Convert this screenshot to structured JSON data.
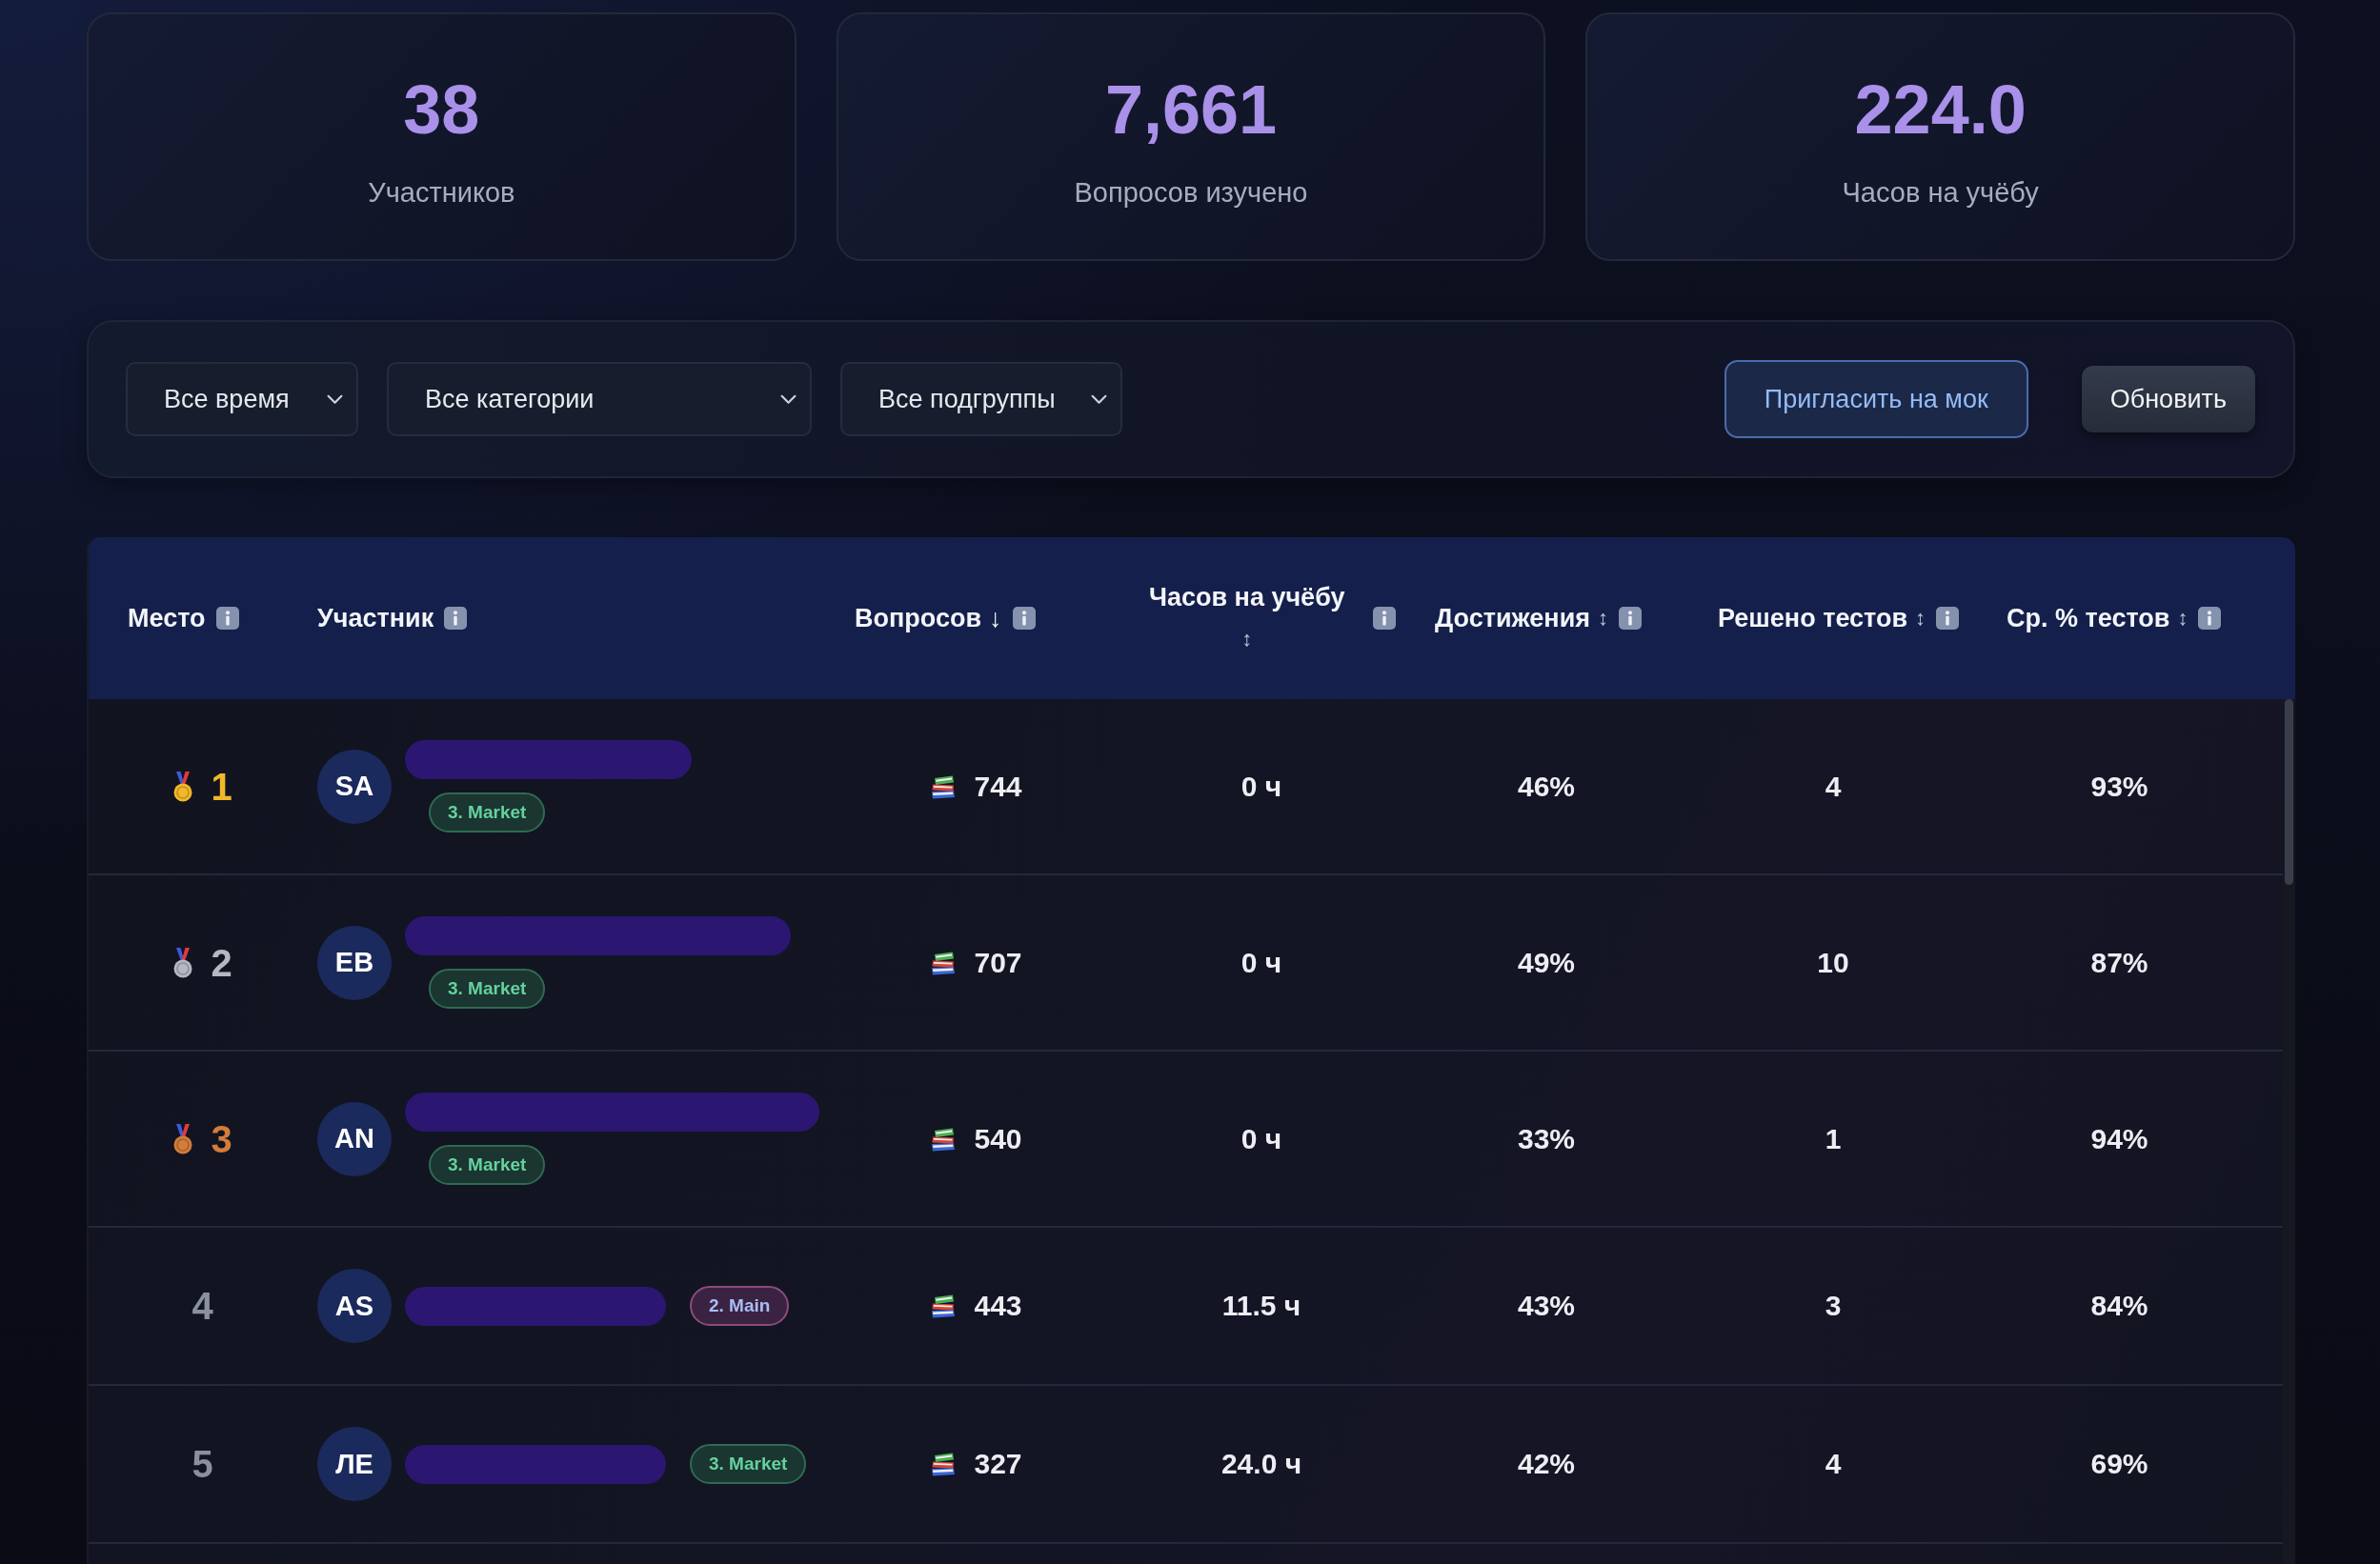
{
  "stats": [
    {
      "value": "38",
      "label": "Участников"
    },
    {
      "value": "7,661",
      "label": "Вопросов изучено"
    },
    {
      "value": "224.0",
      "label": "Часов на учёбу"
    }
  ],
  "filters": {
    "dropdowns": [
      {
        "value": "Все время"
      },
      {
        "value": "Все категории"
      },
      {
        "value": "Все подгруппы"
      }
    ],
    "buttons": [
      {
        "label": "Пригласить на мок",
        "kind": "primary"
      },
      {
        "label": "Обновить",
        "kind": "secondary"
      }
    ]
  },
  "table": {
    "columns": [
      {
        "label": "Место"
      },
      {
        "label": "Участник"
      },
      {
        "label": "Вопросов",
        "sort": "↓",
        "sorted": true
      },
      {
        "label": "Часов на учёбу",
        "sort": "↕",
        "sorted": false
      },
      {
        "label": "Достижения",
        "sort": "↕",
        "sorted": false
      },
      {
        "label": "Решено тестов",
        "sort": "↕",
        "sorted": false
      },
      {
        "label": "Ср. % тестов",
        "sort": "↕",
        "sorted": false
      }
    ],
    "rows": [
      {
        "rank": "1",
        "medal": {
          "color": "#f2b829"
        },
        "initials": "SA",
        "tag": {
          "label": "3. Market",
          "kind": "market"
        },
        "questions": "744",
        "hours": "0 ч",
        "achievements": "46%",
        "tests_solved": "4",
        "avg_test": "93%"
      },
      {
        "rank": "2",
        "medal": {
          "color": "#b3b8c3"
        },
        "initials": "EB",
        "tag": {
          "label": "3. Market",
          "kind": "market"
        },
        "questions": "707",
        "hours": "0 ч",
        "achievements": "49%",
        "tests_solved": "10",
        "avg_test": "87%"
      },
      {
        "rank": "3",
        "medal": {
          "color": "#d47c3a"
        },
        "initials": "AN",
        "tag": {
          "label": "3. Market",
          "kind": "market"
        },
        "questions": "540",
        "hours": "0 ч",
        "achievements": "33%",
        "tests_solved": "1",
        "avg_test": "94%"
      },
      {
        "rank": "4",
        "initials": "AS",
        "tag": {
          "label": "2. Main",
          "kind": "main"
        },
        "questions": "443",
        "hours": "11.5 ч",
        "achievements": "43%",
        "tests_solved": "3",
        "avg_test": "84%"
      },
      {
        "rank": "5",
        "initials": "ЛЕ",
        "tag": {
          "label": "3. Market",
          "kind": "market"
        },
        "questions": "327",
        "hours": "24.0 ч",
        "achievements": "42%",
        "tests_solved": "4",
        "avg_test": "69%"
      }
    ]
  }
}
